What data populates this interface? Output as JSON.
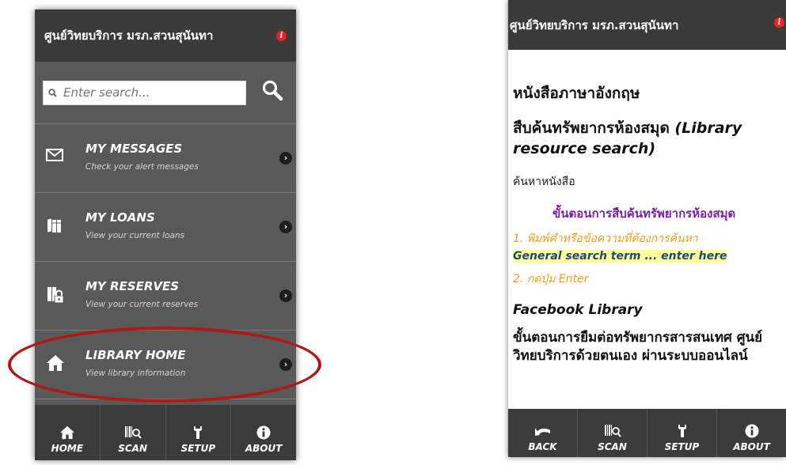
{
  "left": {
    "header_title": "ศูนย์วิทยบริการ มรภ.สวนสุนันทา",
    "info_icon": "i",
    "search": {
      "placeholder": "Enter search..."
    },
    "menu": [
      {
        "title": "MY MESSAGES",
        "subtitle": "Check your alert messages",
        "icon": "envelope-icon"
      },
      {
        "title": "MY LOANS",
        "subtitle": "View your current loans",
        "icon": "books-icon"
      },
      {
        "title": "MY RESERVES",
        "subtitle": "View your current reserves",
        "icon": "locked-books-icon"
      },
      {
        "title": "LIBRARY HOME",
        "subtitle": "View library information",
        "icon": "home-icon"
      }
    ],
    "tabs": [
      {
        "label": "HOME",
        "icon": "home-icon"
      },
      {
        "label": "SCAN",
        "icon": "barcode-icon"
      },
      {
        "label": "SETUP",
        "icon": "wrench-icon"
      },
      {
        "label": "ABOUT",
        "icon": "info-icon"
      }
    ],
    "highlight_color": "#b01818"
  },
  "right": {
    "header_title": "ศูนย์วิทยบริการ มรภ.สวนสุนันทา",
    "books_heading": "หนังสือภาษาอังกฤษ",
    "search_heading_th": "สืบค้นทรัพยากรห้องสมุด",
    "search_heading_en": "(Library resource search)",
    "find_books": "ค้นหาหนังสือ",
    "steps_heading": "ขั้นตอนการสืบค้นทรัพยากรห้องสมุด",
    "step1_th": "1. พิมพ์คำหรือข้อความที่ต้องการค้นหา",
    "step1_en": "General search term ... enter here",
    "step2": "2. กดปุ่ม Enter",
    "facebook": "Facebook Library",
    "self_loan": "ขั้นตอนการยืมต่อทรัพยากรสารสนเทศ ศูนย์วิทยบริการด้วยตนเอง ผ่านระบบออนไลน์",
    "tabs": [
      {
        "label": "BACK",
        "icon": "back-arrow-icon"
      },
      {
        "label": "SCAN",
        "icon": "barcode-icon"
      },
      {
        "label": "SETUP",
        "icon": "wrench-icon"
      },
      {
        "label": "ABOUT",
        "icon": "info-icon"
      }
    ]
  }
}
